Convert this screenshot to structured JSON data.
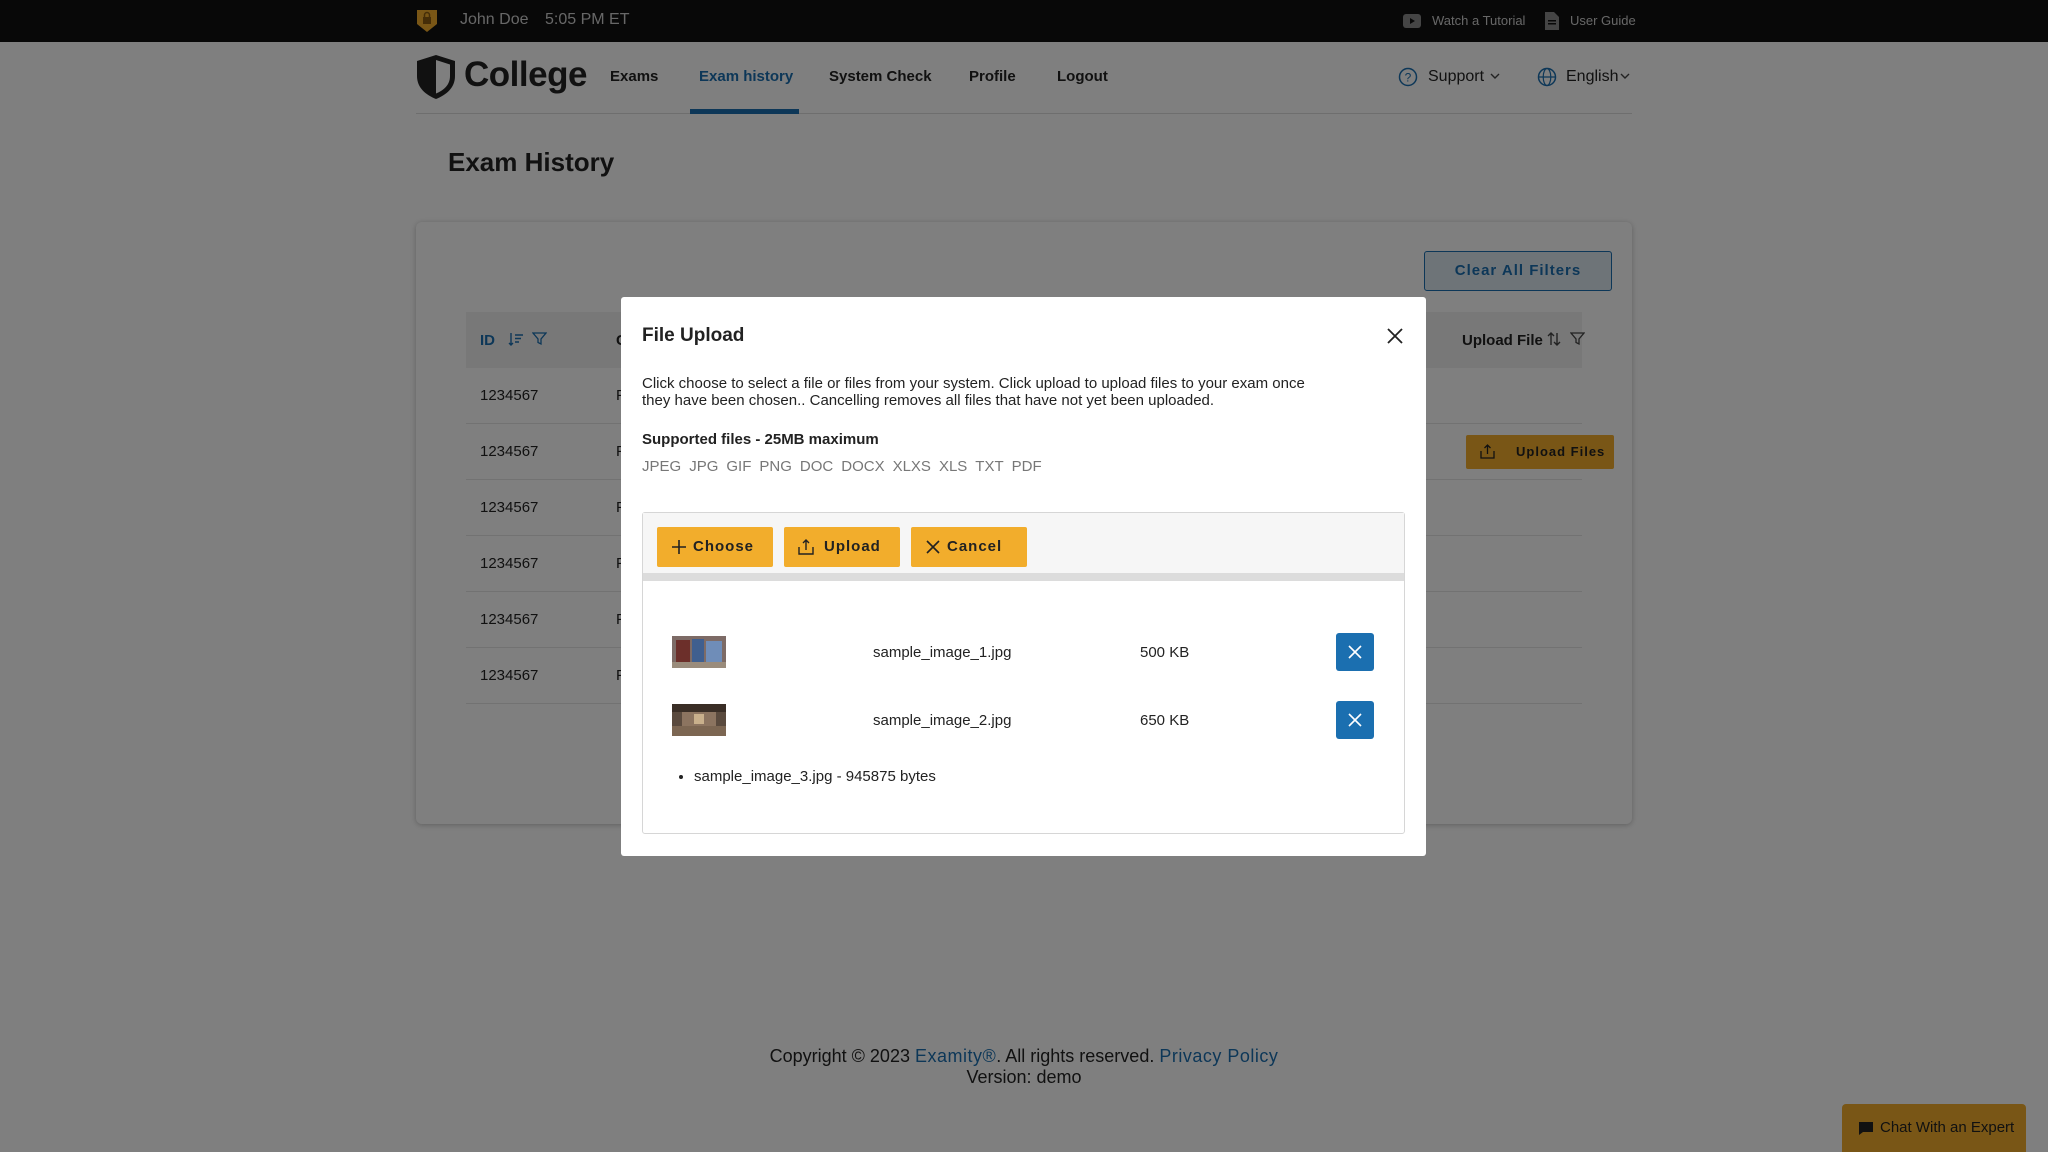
{
  "topbar": {
    "user_name": "John Doe",
    "time": "5:05 PM ET",
    "tutorial_label": "Watch a Tutorial",
    "guide_label": "User Guide"
  },
  "header": {
    "logo_text": "College",
    "nav": [
      "Exams",
      "Exam history",
      "System Check",
      "Profile",
      "Logout"
    ],
    "active_nav": "Exam history",
    "support_label": "Support",
    "language_label": "English"
  },
  "page": {
    "title": "Exam History",
    "clear_filters_label": "Clear All Filters",
    "columns": {
      "id": "ID",
      "second_partial": "C",
      "upload": "Upload File"
    },
    "rows": [
      {
        "id": "1234567",
        "c2": "F"
      },
      {
        "id": "1234567",
        "c2": "F",
        "upload_label": "Upload Files"
      },
      {
        "id": "1234567",
        "c2": "F"
      },
      {
        "id": "1234567",
        "c2": "F"
      },
      {
        "id": "1234567",
        "c2": "F"
      },
      {
        "id": "1234567",
        "c2": "F"
      }
    ]
  },
  "modal": {
    "title": "File Upload",
    "description": "Click choose to select a file or files from your system. Click upload to upload files to your exam once they have been chosen.. Cancelling removes all files that have not yet been uploaded.",
    "supported_title": "Supported files - 25MB maximum",
    "file_types": [
      "JPEG",
      "JPG",
      "GIF",
      "PNG",
      "DOC",
      "DOCX",
      "XLXS",
      "XLS",
      "TXT",
      "PDF"
    ],
    "buttons": {
      "choose": "Choose",
      "upload": "Upload",
      "cancel": "Cancel"
    },
    "files": [
      {
        "name": "sample_image_1.jpg",
        "size": "500 KB"
      },
      {
        "name": "sample_image_2.jpg",
        "size": "650 KB"
      }
    ],
    "pending_files": [
      "sample_image_3.jpg - 945875 bytes"
    ]
  },
  "footer": {
    "copyright_prefix": "Copyright © 2023",
    "brand_link": "Examity®",
    "rights": ".  All rights reserved.",
    "privacy_link": "Privacy Policy",
    "version": "Version: demo"
  },
  "chat": {
    "label": "Chat With an Expert"
  },
  "colors": {
    "accent": "#1b6fb0",
    "button_yellow": "#f2ad2c",
    "topbar": "#111111"
  }
}
